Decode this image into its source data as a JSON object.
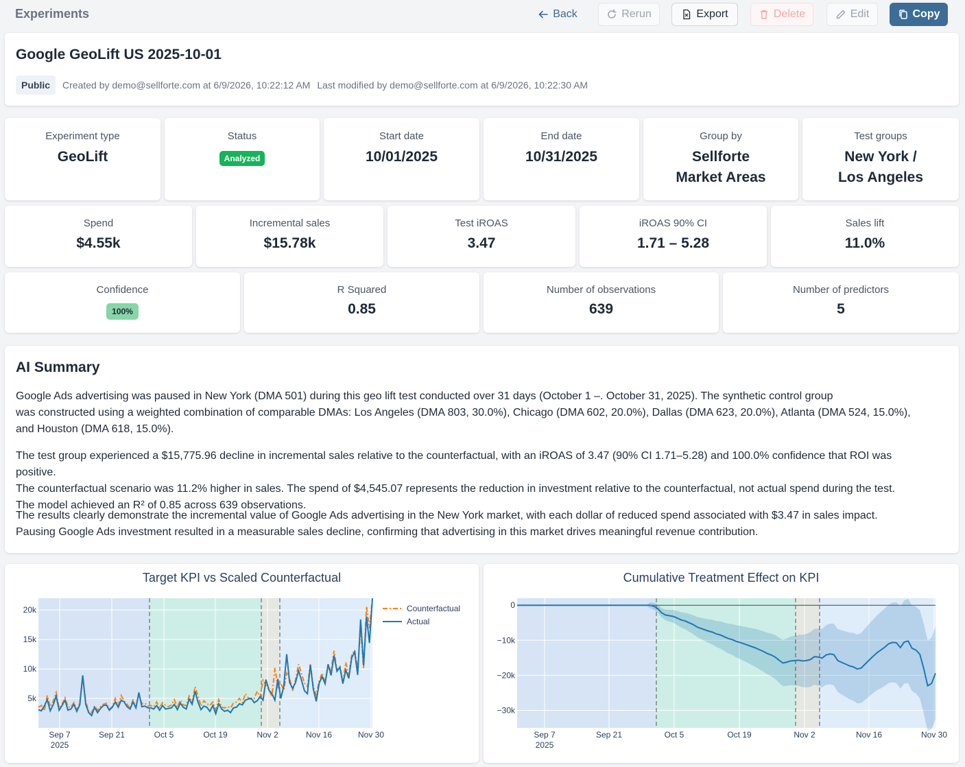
{
  "topbar": {
    "title": "Experiments",
    "back": "Back",
    "rerun": "Rerun",
    "export": "Export",
    "delete": "Delete",
    "edit": "Edit",
    "copy": "Copy"
  },
  "experiment": {
    "name": "Google GeoLift US 2025-10-01",
    "visibility": "Public",
    "created": "Created by demo@sellforte.com at 6/9/2026, 10:22:12 AM",
    "modified": "Last modified by demo@sellforte.com at 6/9/2026, 10:22:30 AM"
  },
  "row1": [
    {
      "label": "Experiment type",
      "value": "GeoLift"
    },
    {
      "label": "Status",
      "value": "Analyzed"
    },
    {
      "label": "Start date",
      "value": "10/01/2025"
    },
    {
      "label": "End date",
      "value": "10/31/2025"
    },
    {
      "label": "Group by",
      "value_l1": "Sellforte",
      "value_l2": "Market Areas"
    },
    {
      "label": "Test groups",
      "value_l1": "New York /",
      "value_l2": "Los Angeles"
    }
  ],
  "row2": [
    {
      "label": "Spend",
      "value": "$4.55k"
    },
    {
      "label": "Incremental sales",
      "value": "$15.78k"
    },
    {
      "label": "Test iROAS",
      "value": "3.47"
    },
    {
      "label": "iROAS 90% CI",
      "value": "1.71 – 5.28"
    },
    {
      "label": "Sales lift",
      "value": "11.0%"
    }
  ],
  "row3": [
    {
      "label": "Confidence",
      "value": "100%"
    },
    {
      "label": "R Squared",
      "value": "0.85"
    },
    {
      "label": "Number of observations",
      "value": "639"
    },
    {
      "label": "Number of predictors",
      "value": "5"
    }
  ],
  "summary": {
    "title": "AI Summary",
    "p1": [
      "Google Ads advertising was paused in New York (DMA 501) during this geo lift test conducted over 31 days (October 1 –. October 31, 2025). The synthetic control group",
      "was constructed using a weighted combination of comparable DMAs: Los Angeles (DMA 803, 30.0%), Chicago (DMA 602, 20.0%), Dallas (DMA 623, 20.0%), Atlanta (DMA 524, 15.0%),",
      "and Houston (DMA 618, 15.0%)."
    ],
    "p2": [
      "The test group experienced a $15,775.96 decline in incremental sales relative to the counterfactual, with an iROAS of 3.47 (90% CI 1.71–5.28) and 100.0% confidence that ROI was positive.",
      "The counterfactual scenario was 11.2% higher in sales. The spend of $4,545.07 represents the reduction in investment relative to the counterfactual, not actual spend during the test.",
      "The model achieved an R² of 0.85 across 639 observations."
    ],
    "p3": [
      "The results clearly demonstrate the incremental value of Google Ads advertising in the New York market, with each dollar of reduced spend associated with $3.47 in sales impact.",
      "Pausing Google Ads investment resulted in a measurable sales decline, confirming that advertising in this market drives meaningful revenue contribution."
    ]
  },
  "chart_data": [
    {
      "type": "line",
      "title": "Target KPI vs Scaled Counterfactual",
      "x_ticks": [
        "Sep 7\n2025",
        "Sep 21",
        "Oct 5",
        "Oct 19",
        "Nov 2",
        "Nov 16",
        "Nov 30"
      ],
      "y_ticks": [
        "5k",
        "10k",
        "15k",
        "20k"
      ],
      "ylim": [
        0,
        22000
      ],
      "legend": "top-right",
      "series": [
        {
          "name": "Counterfactual",
          "color": "#ff7f0e",
          "dash": "dashdot",
          "values": [
            3500,
            3800,
            2900,
            5500,
            3600,
            4500,
            6000,
            3400,
            4000,
            5100,
            3600,
            3500,
            4300,
            3100,
            4200,
            8600,
            4500,
            2800,
            2600,
            3700,
            3000,
            3600,
            4000,
            4200,
            3200,
            3600,
            5000,
            3800,
            5500,
            4600,
            4000,
            3300,
            4700,
            3600,
            5700,
            4100,
            4200,
            3700,
            3800,
            3600,
            4400,
            3400,
            4300,
            3800,
            3600,
            3900,
            4800,
            3500,
            4700,
            3900,
            3800,
            5400,
            4300,
            7000,
            5400,
            3700,
            4600,
            4100,
            3800,
            4400,
            3100,
            4800,
            3500,
            3400,
            3600,
            3400,
            4200,
            4400,
            5000,
            4300,
            5800,
            5100,
            4900,
            5000,
            6200,
            5200,
            8100,
            7200,
            6500,
            5300,
            10200,
            6900,
            7600,
            6400,
            9300,
            8400,
            6300,
            8200,
            10800,
            9200,
            7600,
            7000,
            10800,
            7000,
            5600,
            8000,
            9300,
            7800,
            10400,
            9800,
            13100,
            9800,
            10400,
            7900,
            11100,
            8800,
            12400,
            13200,
            10000,
            17000,
            10000,
            20600,
            16900,
            22000
          ]
        },
        {
          "name": "Actual",
          "color": "#1f77b4",
          "dash": "solid",
          "values": [
            3100,
            2900,
            3700,
            4800,
            2900,
            3900,
            5400,
            3000,
            3800,
            4700,
            3000,
            3200,
            4000,
            2800,
            3900,
            8900,
            4000,
            2600,
            2100,
            3500,
            2600,
            3300,
            3800,
            3900,
            3000,
            3500,
            4400,
            3500,
            4700,
            4400,
            3600,
            3200,
            4400,
            3400,
            6000,
            3600,
            3700,
            3400,
            3400,
            3200,
            3800,
            3000,
            3800,
            3200,
            3300,
            3400,
            4000,
            3100,
            4200,
            3500,
            3200,
            4900,
            4000,
            6200,
            4400,
            3100,
            3700,
            3500,
            2800,
            3800,
            2400,
            4100,
            3200,
            2800,
            3000,
            2600,
            3400,
            3500,
            4100,
            3900,
            4700,
            4900,
            5000,
            4300,
            4600,
            5300,
            4700,
            8200,
            6400,
            5800,
            4700,
            8300,
            5000,
            7000,
            12500,
            7700,
            6700,
            7700,
            9700,
            8100,
            6300,
            5800,
            10700,
            6600,
            4500,
            7600,
            8700,
            7500,
            10800,
            8900,
            12300,
            9600,
            10300,
            7500,
            9800,
            8400,
            11900,
            12900,
            9000,
            18400,
            10600,
            18900,
            14400,
            22000
          ]
        }
      ]
    },
    {
      "type": "area",
      "title": "Cumulative Treatment Effect on KPI",
      "x_ticks": [
        "Sep 7\n2025",
        "Sep 21",
        "Oct 5",
        "Oct 19",
        "Nov 2",
        "Nov 16",
        "Nov 30"
      ],
      "y_ticks": [
        "0",
        "−10k",
        "−20k",
        "−30k"
      ],
      "ylim": [
        -35000,
        2000
      ],
      "series": [
        {
          "name": "",
          "color": "#1f77b4",
          "values": [
            0,
            0,
            0,
            0,
            0,
            0,
            0,
            0,
            0,
            0,
            0,
            0,
            0,
            0,
            0,
            0,
            0,
            0,
            0,
            0,
            0,
            0,
            0,
            0,
            0,
            0,
            0,
            0,
            0,
            0,
            0,
            0,
            0,
            0,
            0,
            -300,
            -1000,
            -2200,
            -2800,
            -3000,
            -3200,
            -3700,
            -4200,
            -4500,
            -5000,
            -5500,
            -6200,
            -6600,
            -7000,
            -7400,
            -7700,
            -8200,
            -8500,
            -9000,
            -9500,
            -9800,
            -10300,
            -10600,
            -11000,
            -11400,
            -11800,
            -12200,
            -12700,
            -13200,
            -13800,
            -14200,
            -14800,
            -15700,
            -16500,
            -16200,
            -15900,
            -15800,
            -15700,
            -15900,
            -15800,
            -15500,
            -14700,
            -14800,
            -15100,
            -14200,
            -13900,
            -14100,
            -15800,
            -16300,
            -16800,
            -17300,
            -17600,
            -18200,
            -17900,
            -16800,
            -15700,
            -14600,
            -13600,
            -12800,
            -12000,
            -11000,
            -10600,
            -10700,
            -12100,
            -10500,
            -10200,
            -12300,
            -12800,
            -14000,
            -18100,
            -23000,
            -22300,
            -19400
          ]
        }
      ]
    }
  ]
}
